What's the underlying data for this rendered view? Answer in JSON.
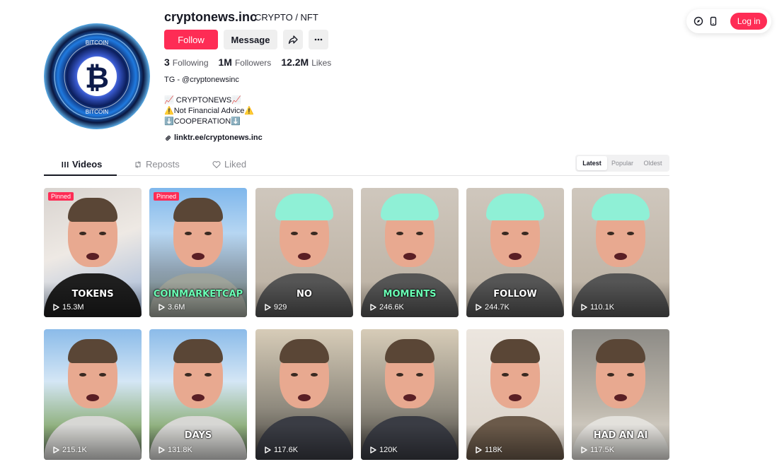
{
  "top_actions": {
    "login_label": "Log in",
    "icons": [
      "compass-icon",
      "phone-icon"
    ]
  },
  "profile": {
    "username": "cryptonews.inc",
    "nickname": "CRYPTO / NFT",
    "avatar_text_top": "BITCOIN",
    "avatar_text_bottom": "BITCOIN",
    "avatar_symbol": "₿",
    "follow_label": "Follow",
    "message_label": "Message",
    "stats": [
      {
        "value": "3",
        "label": "Following"
      },
      {
        "value": "1M",
        "label": "Followers"
      },
      {
        "value": "12.2M",
        "label": "Likes"
      }
    ],
    "bio": [
      "TG - @cryptonewsinc",
      "📈 CRYPTONEWS📈",
      "⚠️Not Financial Advice⚠️",
      "⬇️COOPERATION⬇️"
    ],
    "link": "linktr.ee/cryptonews.inc"
  },
  "tabs": [
    {
      "label": "Videos",
      "icon": "grid-icon"
    },
    {
      "label": "Reposts",
      "icon": "repost-icon"
    },
    {
      "label": "Liked",
      "icon": "heart-icon"
    }
  ],
  "sort": [
    "Latest",
    "Popular",
    "Oldest"
  ],
  "videos": [
    {
      "views": "15.3M",
      "pinned": "Pinned",
      "caption": "TOKENS",
      "style": "office"
    },
    {
      "views": "3.6M",
      "pinned": "Pinned",
      "caption": "COINMARKETCAP",
      "style": "outdoor"
    },
    {
      "views": "929",
      "caption": "NO",
      "style": "cap"
    },
    {
      "views": "246.6K",
      "caption": "MOMENTS",
      "style": "cap"
    },
    {
      "views": "244.7K",
      "caption": "FOLLOW",
      "style": "cap"
    },
    {
      "views": "110.1K",
      "caption": "",
      "style": "cap"
    },
    {
      "views": "215.1K",
      "caption": "",
      "style": "outdoor2"
    },
    {
      "views": "131.8K",
      "caption": "DAYS",
      "style": "outdoor2"
    },
    {
      "views": "117.6K",
      "caption": "",
      "style": "hall"
    },
    {
      "views": "120K",
      "caption": "",
      "style": "hall"
    },
    {
      "views": "118K",
      "caption": "",
      "style": "room"
    },
    {
      "views": "117.5K",
      "caption": "HAD AN AI",
      "style": "office2"
    }
  ]
}
